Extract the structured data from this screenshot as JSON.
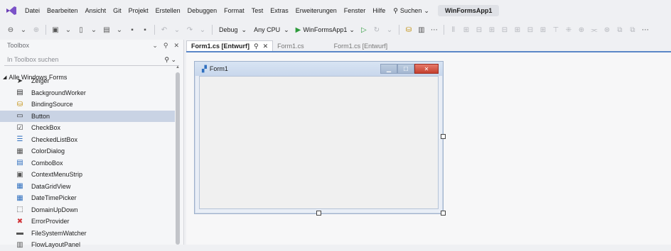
{
  "menu": {
    "items": [
      "Datei",
      "Bearbeiten",
      "Ansicht",
      "Git",
      "Projekt",
      "Erstellen",
      "Debuggen",
      "Format",
      "Test",
      "Extras",
      "Erweiterungen",
      "Fenster",
      "Hilfe"
    ],
    "search_label": "Suchen",
    "solution_title": "WinFormsApp1"
  },
  "toolbar": {
    "configuration": "Debug",
    "platform": "Any CPU",
    "start_project": "WinFormsApp1"
  },
  "toolbox": {
    "title": "Toolbox",
    "search_placeholder": "In Toolbox suchen",
    "group_label": "Alle Windows Forms",
    "items": [
      {
        "label": "Zeiger",
        "icon": "pointer-icon",
        "glyph": "➤",
        "color": "#333333"
      },
      {
        "label": "BackgroundWorker",
        "icon": "background-worker-icon",
        "glyph": "▤",
        "color": "#333333"
      },
      {
        "label": "BindingSource",
        "icon": "binding-source-icon",
        "glyph": "⛁",
        "color": "#c08a00"
      },
      {
        "label": "Button",
        "icon": "button-icon",
        "glyph": "▭",
        "color": "#333333"
      },
      {
        "label": "CheckBox",
        "icon": "checkbox-icon",
        "glyph": "☑",
        "color": "#333333"
      },
      {
        "label": "CheckedListBox",
        "icon": "checked-list-box-icon",
        "glyph": "☰",
        "color": "#2f6fbf"
      },
      {
        "label": "ColorDialog",
        "icon": "color-dialog-icon",
        "glyph": "▦",
        "color": "#555555"
      },
      {
        "label": "ComboBox",
        "icon": "combobox-icon",
        "glyph": "▤",
        "color": "#2f6fbf"
      },
      {
        "label": "ContextMenuStrip",
        "icon": "context-menu-strip-icon",
        "glyph": "▣",
        "color": "#555555"
      },
      {
        "label": "DataGridView",
        "icon": "data-grid-view-icon",
        "glyph": "▦",
        "color": "#2f6fbf"
      },
      {
        "label": "DateTimePicker",
        "icon": "date-time-picker-icon",
        "glyph": "▦",
        "color": "#2f6fbf"
      },
      {
        "label": "DomainUpDown",
        "icon": "domain-up-down-icon",
        "glyph": "⬚",
        "color": "#333333"
      },
      {
        "label": "ErrorProvider",
        "icon": "error-provider-icon",
        "glyph": "✖",
        "color": "#d13438"
      },
      {
        "label": "FileSystemWatcher",
        "icon": "file-system-watcher-icon",
        "glyph": "▬",
        "color": "#555555"
      },
      {
        "label": "FlowLayoutPanel",
        "icon": "flow-layout-panel-icon",
        "glyph": "▥",
        "color": "#555555"
      }
    ],
    "selected_item": "Button"
  },
  "tabs": [
    {
      "label": "Form1.cs [Entwurf]",
      "active": true
    },
    {
      "label": "Form1.cs",
      "active": false
    },
    {
      "label": "Form1.cs [Entwurf]",
      "active": false
    }
  ],
  "form": {
    "title": "Form1"
  }
}
